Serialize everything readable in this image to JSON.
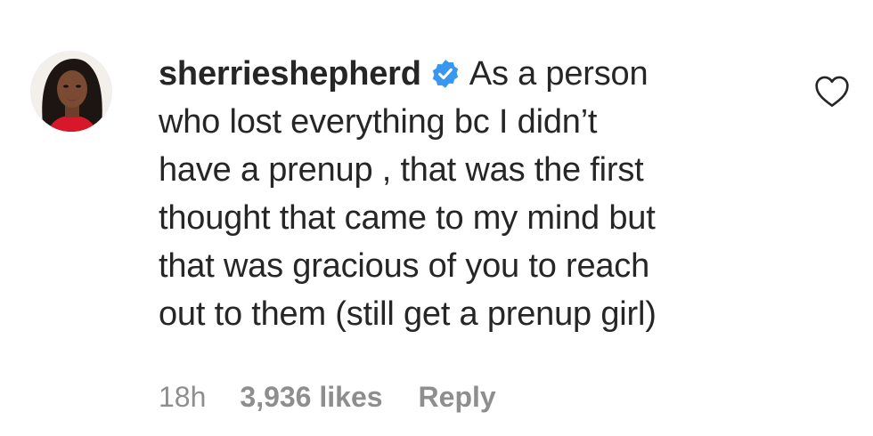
{
  "comment": {
    "username": "sherrieshepherd",
    "verified_icon": "verified-badge-icon",
    "text_lines": [
      "As a person",
      "who lost everything bc I didn’t",
      "have a prenup , that was the first",
      "thought that came to my mind but",
      "that was gracious of you to reach",
      "out to them (still get a prenup girl)"
    ],
    "timestamp": "18h",
    "likes": "3,936 likes",
    "reply_label": "Reply",
    "like_icon": "heart-outline-icon"
  },
  "colors": {
    "text": "#262626",
    "secondary": "#8e8e8e",
    "verified": "#3897f0",
    "background": "#ffffff"
  }
}
